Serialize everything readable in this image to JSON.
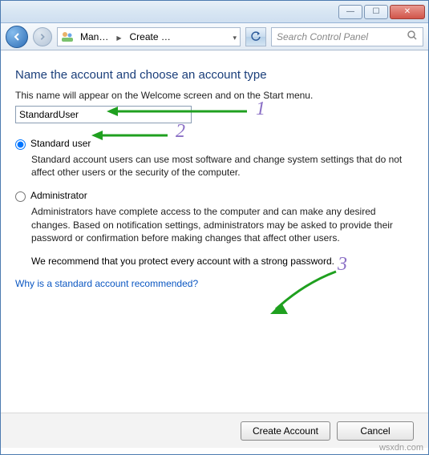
{
  "window": {
    "minimize_glyph": "—",
    "maximize_glyph": "☐",
    "close_glyph": "✕"
  },
  "nav": {
    "crumb1": "Man…",
    "crumb2": "Create …",
    "search_placeholder": "Search Control Panel"
  },
  "heading": "Name the account and choose an account type",
  "subheading": "This name will appear on the Welcome screen and on the Start menu.",
  "input_value": "StandardUser",
  "options": {
    "standard": {
      "label": "Standard user",
      "desc": "Standard account users can use most software and change system settings that do not affect other users or the security of the computer."
    },
    "admin": {
      "label": "Administrator",
      "desc": "Administrators have complete access to the computer and can make any desired changes. Based on notification settings, administrators may be asked to provide their password or confirmation before making changes that affect other users."
    },
    "recommend": "We recommend that you protect every account with a strong password."
  },
  "link_text": "Why is a standard account recommended?",
  "buttons": {
    "create": "Create Account",
    "cancel": "Cancel"
  },
  "annotations": {
    "n1": "1",
    "n2": "2",
    "n3": "3"
  },
  "watermark": "wsxdn.com"
}
